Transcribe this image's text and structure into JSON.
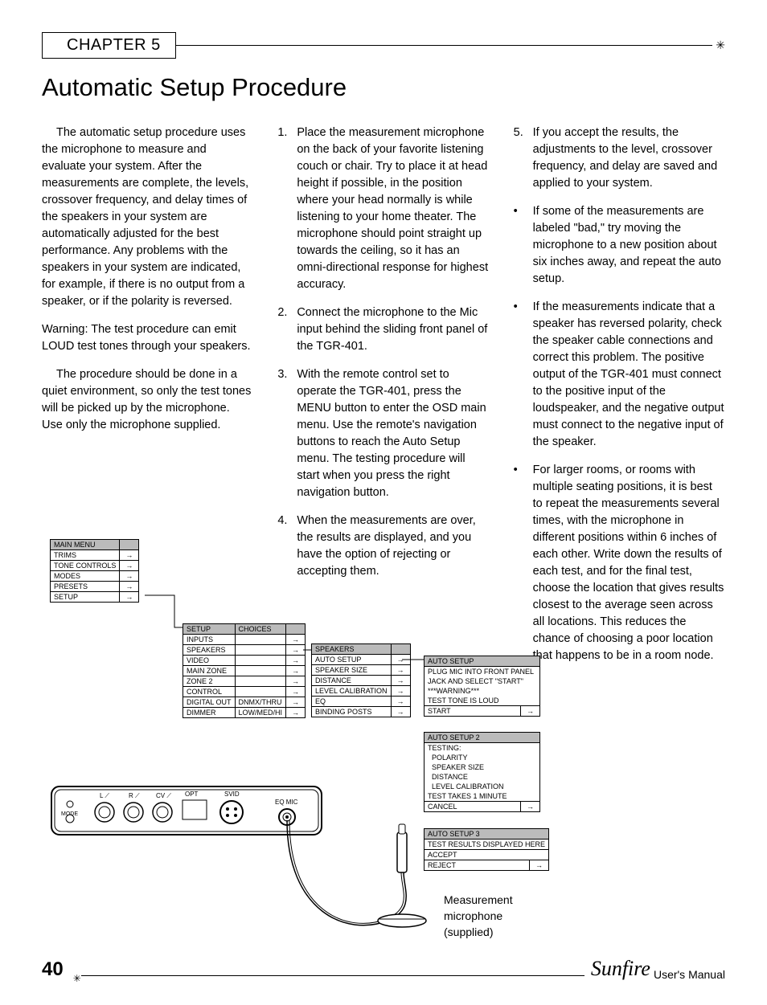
{
  "chapter": "CHAPTER 5",
  "title": "Automatic Setup Procedure",
  "col1": {
    "p1": "The automatic setup procedure uses the microphone to measure and evaluate your system. After the measurements are complete, the levels, crossover frequency, and delay times of the speakers in your system are automatically adjusted for the best performance. Any problems with the speakers in your system are indicated, for example, if there is no output from a speaker, or if the polarity is reversed.",
    "p2": "Warning: The test procedure can emit LOUD test tones through your speakers.",
    "p3": "The procedure should be done in a quiet environment, so only the test tones will be picked up by the microphone. Use only the microphone supplied."
  },
  "col2": {
    "s1": "Place the measurement microphone on the back of your favorite listening couch or chair. Try to place it at head height if possible, in the position where your head normally is while listening to your home theater. The microphone should point straight up towards the ceiling, so it has an omni-directional response for highest accuracy.",
    "s2": "Connect the microphone to the Mic input behind the sliding front panel of the TGR-401.",
    "s3": "With the remote control set to operate the TGR-401, press the MENU button to enter the OSD main menu. Use the remote's navigation buttons to reach the Auto Setup menu. The testing procedure will start when you press the right navigation button.",
    "s4": "When the measurements are over, the results are displayed, and you have the option of rejecting or accepting them."
  },
  "col3": {
    "s5": "If you accept the results, the adjustments to the level, crossover frequency, and delay are saved and applied to your system.",
    "b1": "If some of the measurements are labeled \"bad,\" try moving the microphone to a new position about six inches away, and repeat the auto setup.",
    "b2": "If the measurements indicate that a speaker has reversed polarity, check the speaker cable connections and correct this problem. The positive output of the TGR-401 must connect to the positive input of the loudspeaker, and the negative output must connect to the negative input of the speaker.",
    "b3": "For larger rooms, or rooms with multiple seating positions, it is best to repeat the measurements several times, with the microphone in different positions within 6 inches of each other. Write down the results of each test, and for the final test, choose the location that gives results closest to the average seen across all locations. This reduces the chance of choosing a poor location that happens to be in a room node."
  },
  "menus": {
    "main": {
      "header": "MAIN MENU",
      "rows": [
        "TRIMS",
        "TONE CONTROLS",
        "MODES",
        "PRESETS",
        "SETUP"
      ]
    },
    "setup": {
      "headers": [
        "SETUP",
        "CHOICES"
      ],
      "rows": [
        [
          "INPUTS",
          ""
        ],
        [
          "SPEAKERS",
          ""
        ],
        [
          "VIDEO",
          ""
        ],
        [
          "MAIN ZONE",
          ""
        ],
        [
          "ZONE 2",
          ""
        ],
        [
          "CONTROL",
          ""
        ],
        [
          "DIGITAL OUT",
          "DNMX/THRU"
        ],
        [
          "DIMMER",
          "LOW/MED/HI"
        ]
      ]
    },
    "speakers": {
      "header": "SPEAKERS",
      "rows": [
        "AUTO SETUP",
        "SPEAKER SIZE",
        "DISTANCE",
        "LEVEL CALIBRATION",
        "EQ",
        "BINDING POSTS"
      ]
    },
    "auto1": {
      "header": "AUTO SETUP",
      "lines": [
        "PLUG MIC INTO FRONT PANEL",
        "JACK AND SELECT \"START\"",
        "***WARNING***",
        "TEST TONE IS LOUD"
      ],
      "action": "START"
    },
    "auto2": {
      "header": "AUTO SETUP 2",
      "lines": [
        "TESTING:",
        "  POLARITY",
        "  SPEAKER SIZE",
        "  DISTANCE",
        "  LEVEL CALIBRATION",
        "TEST TAKES 1 MINUTE"
      ],
      "action": "CANCEL"
    },
    "auto3": {
      "header": "AUTO SETUP 3",
      "lines": [
        "TEST RESULTS DISPLAYED HERE",
        "ACCEPT"
      ],
      "action": "REJECT"
    }
  },
  "panel": {
    "labels": [
      "L",
      "R",
      "CV",
      "SVID",
      "OPT",
      "EQ MIC",
      "MODE"
    ]
  },
  "mic_label": "Measurement\nmicrophone\n(supplied)",
  "page_number": "40",
  "brand": "Sunfire",
  "manual": "User's Manual"
}
